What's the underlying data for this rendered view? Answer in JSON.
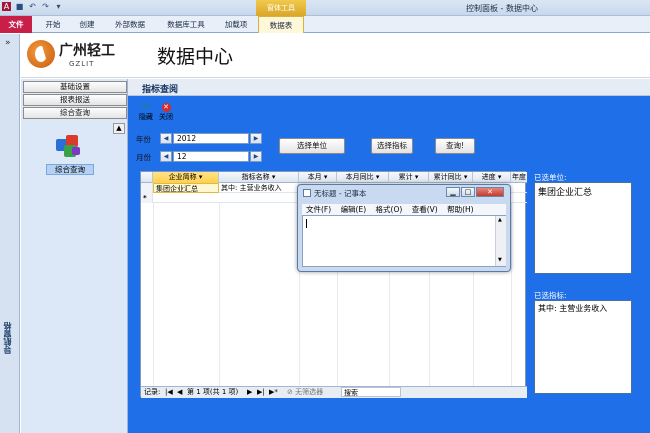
{
  "app": {
    "title": "控制面板 - 数据中心",
    "context_group": "窗体工具"
  },
  "ribbon": {
    "tabs": [
      "文件",
      "开始",
      "创建",
      "外部数据",
      "数据库工具",
      "加载项",
      "数据表"
    ]
  },
  "header": {
    "logo_cn": "广州轻工",
    "logo_en": "GZLIT",
    "title": "数据中心"
  },
  "nav": {
    "strip_label": "导航窗格",
    "buttons": [
      "基础设置",
      "报表报送",
      "综合查询"
    ],
    "item_label": "综合查询"
  },
  "form": {
    "title": "指标查阅",
    "tools": {
      "hide": "隐藏",
      "close": "关闭"
    },
    "year_label": "年份",
    "year_value": "2012",
    "month_label": "月份",
    "month_value": "12",
    "buttons": {
      "select_unit": "选择单位",
      "select_indicator": "选择指标",
      "query": "查询!"
    },
    "selected_unit_label": "已选单位:",
    "selected_unit_value": "集团企业汇总",
    "selected_indicator_label": "已选指标:",
    "selected_indicator_value": "其中: 主营业务收入"
  },
  "datasheet": {
    "columns": [
      "企业简称",
      "指标名称",
      "本月",
      "本月同比",
      "累计",
      "累计同比",
      "进度",
      "年度"
    ],
    "row1": [
      "集团企业汇总",
      "其中: 主营业务收入"
    ],
    "new_row_marker": "*",
    "nav_record": "记录: ",
    "nav_position": "第 1 项(共 1 项)",
    "nav_filter": "无筛选器",
    "nav_search": "搜索"
  },
  "notepad": {
    "title": "无标题 - 记事本",
    "menu": [
      "文件(F)",
      "编辑(E)",
      "格式(O)",
      "查看(V)",
      "帮助(H)"
    ]
  },
  "colors": {
    "form_background": "#1e6fe8",
    "file_tab": "#c71f48",
    "context_tab": "#f2c94c"
  }
}
